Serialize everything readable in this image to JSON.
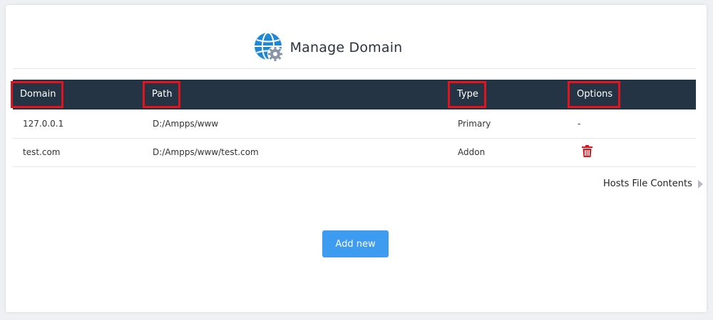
{
  "header": {
    "title": "Manage Domain",
    "icon": "globe-gear-icon"
  },
  "table": {
    "columns": {
      "domain": "Domain",
      "path": "Path",
      "type": "Type",
      "options": "Options"
    },
    "rows": [
      {
        "domain": "127.0.0.1",
        "path": "D:/Ampps/www",
        "type": "Primary",
        "options": "-"
      },
      {
        "domain": "test.com",
        "path": "D:/Ampps/www/test.com",
        "type": "Addon",
        "options_icon": "trash-icon"
      }
    ]
  },
  "hosts_link": {
    "label": "Hosts File Contents",
    "icon": "caret-right-icon"
  },
  "actions": {
    "add_new_label": "Add new"
  },
  "colors": {
    "header_bg": "#243444",
    "highlight": "#e0141e",
    "accent_button": "#3d9bf0",
    "delete": "#e0141e",
    "globe": "#1e88d4"
  }
}
